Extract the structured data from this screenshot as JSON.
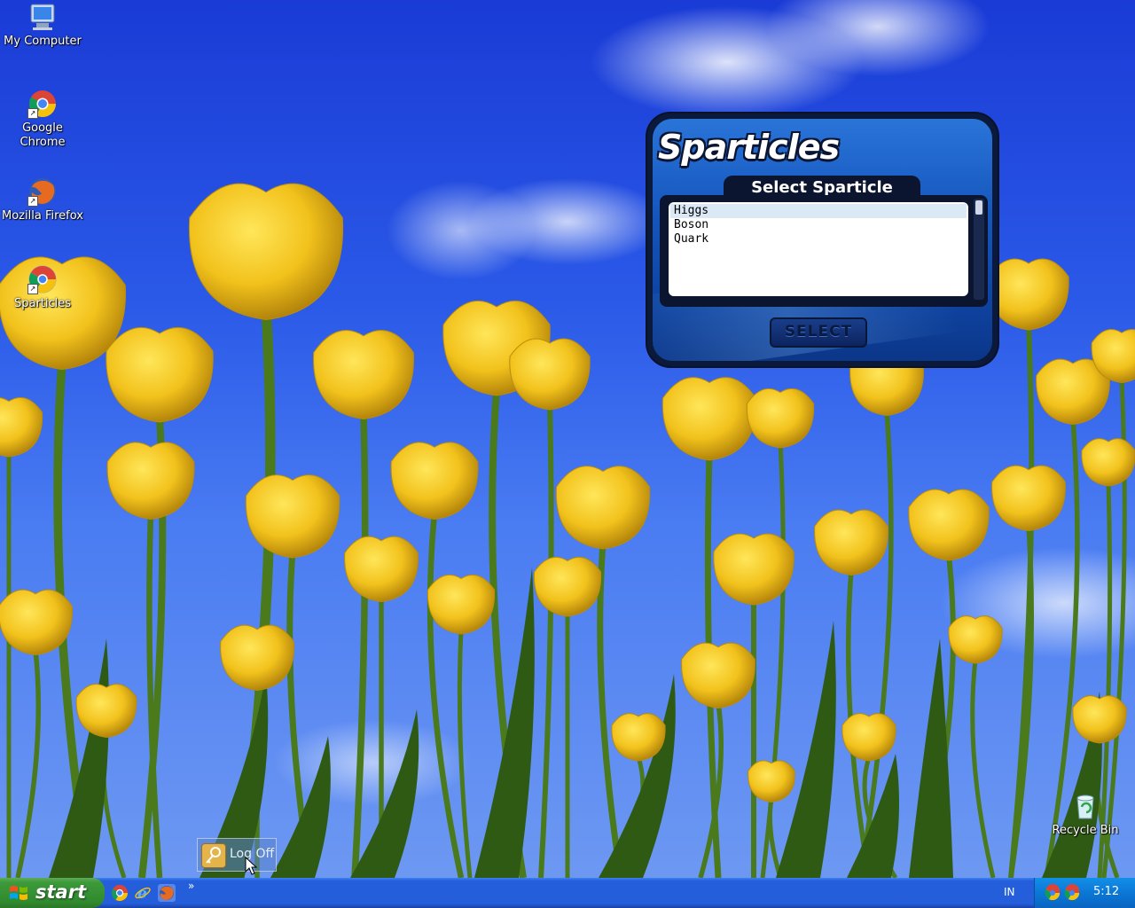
{
  "desktop": {
    "icons": [
      {
        "label": "My Computer",
        "icon": "my-computer-icon"
      },
      {
        "label": "Google Chrome",
        "label_line1": "Google",
        "label_line2": "Chrome",
        "icon": "chrome-icon"
      },
      {
        "label": "Mozilla Firefox",
        "icon": "firefox-icon"
      },
      {
        "label": "Sparticles",
        "icon": "sparticles-icon"
      },
      {
        "label": "Recycle Bin",
        "icon": "recycle-bin-icon"
      }
    ]
  },
  "sparticles": {
    "logo": "Sparticles",
    "heading": "Select Sparticle",
    "items": [
      "Higgs",
      "Boson",
      "Quark"
    ],
    "selected_index": 0,
    "select_button": "SELECT"
  },
  "logoff": {
    "label": "Log Off"
  },
  "taskbar": {
    "start_label": "start",
    "quick_launch": [
      "chrome-icon",
      "ie-icon",
      "firefox-icon"
    ],
    "overflow": "»",
    "language": "IN",
    "clock": "5:12"
  },
  "colors": {
    "sky": "#2b5ae8",
    "taskbar": "#245edb",
    "start_button": "#3c9a3a",
    "tray": "#0b77d6",
    "window_blue": "#1556bd",
    "tulip_yellow": "#f2c21c"
  }
}
